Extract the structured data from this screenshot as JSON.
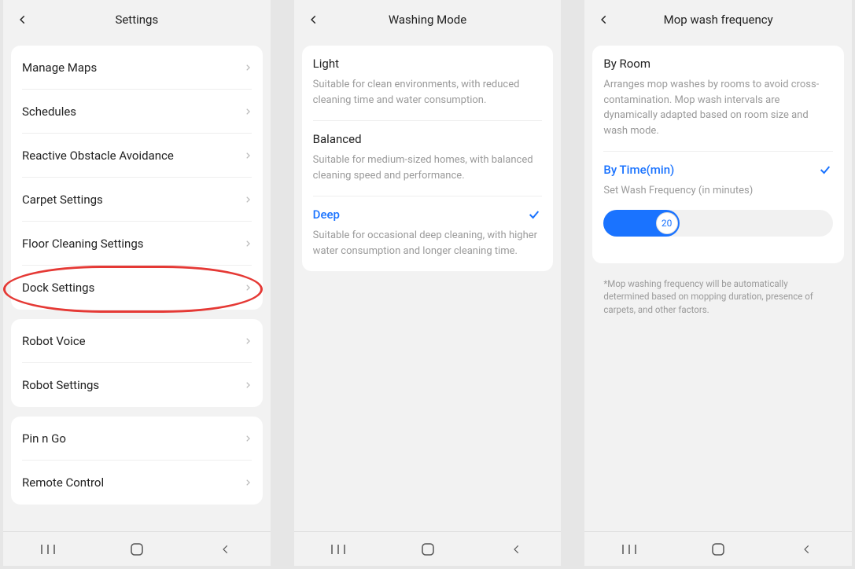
{
  "screens": {
    "settings": {
      "title": "Settings",
      "groups": [
        [
          "Manage Maps",
          "Schedules",
          "Reactive Obstacle Avoidance",
          "Carpet Settings",
          "Floor Cleaning Settings",
          "Dock Settings"
        ],
        [
          "Robot Voice",
          "Robot Settings"
        ],
        [
          "Pin n Go",
          "Remote Control"
        ]
      ],
      "highlighted": "Dock Settings"
    },
    "washing": {
      "title": "Washing Mode",
      "options": [
        {
          "title": "Light",
          "desc": "Suitable for clean environments, with reduced cleaning time and water consumption.",
          "selected": false
        },
        {
          "title": "Balanced",
          "desc": "Suitable for medium-sized homes, with balanced cleaning speed and performance.",
          "selected": false
        },
        {
          "title": "Deep",
          "desc": "Suitable for occasional deep cleaning, with higher water consumption and longer cleaning time.",
          "selected": true
        }
      ]
    },
    "mopfreq": {
      "title": "Mop wash frequency",
      "options": [
        {
          "title": "By Room",
          "desc": "Arranges mop washes by rooms to avoid cross-contamination. Mop wash intervals are dynamically adapted based on room size and wash mode.",
          "selected": false
        },
        {
          "title": "By Time(min)",
          "desc": "Set Wash Frequency (in minutes)",
          "selected": true
        }
      ],
      "slider_value": "20",
      "footnote": "*Mop washing frequency will be automatically determined based on mopping duration, presence of carpets, and other factors."
    }
  }
}
